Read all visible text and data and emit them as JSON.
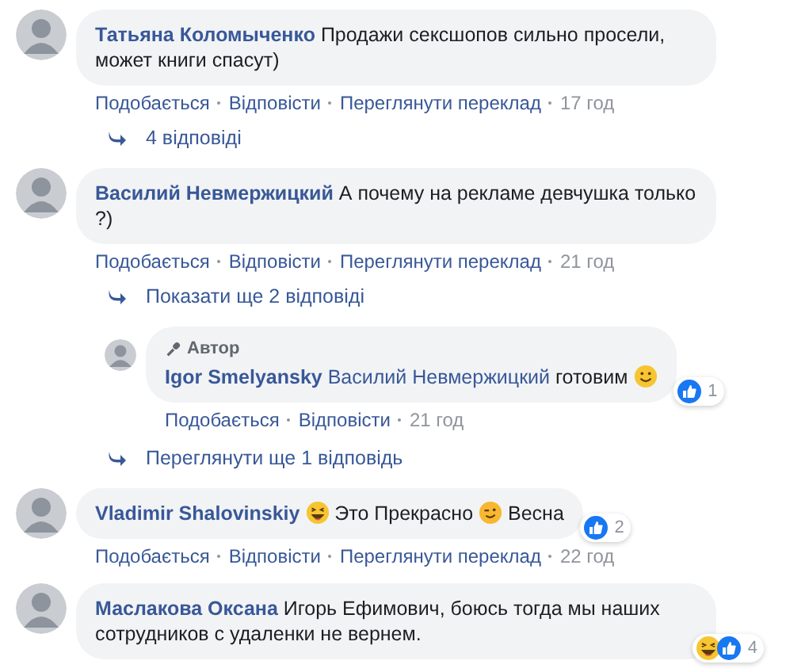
{
  "comments": [
    {
      "kind": "comment",
      "author": "Татьяна Коломыченко",
      "segments": [
        {
          "kind": "text",
          "text": "Продажи сексшопов сильно просели, может книги спасут)"
        }
      ],
      "actions": [
        "Подобається",
        "Відповісти",
        "Переглянути переклад"
      ],
      "time": "17 год",
      "children": [
        {
          "kind": "more",
          "text": "4 відповіді"
        }
      ]
    },
    {
      "kind": "comment",
      "author": "Василий Невмержицкий",
      "segments": [
        {
          "kind": "text",
          "text": "А почему на рекламе девчушка только ?)"
        }
      ],
      "actions": [
        "Подобається",
        "Відповісти",
        "Переглянути переклад"
      ],
      "time": "21 год",
      "children": [
        {
          "kind": "more",
          "text": "Показати ще 2 відповіді"
        },
        {
          "kind": "comment",
          "badge": "Автор",
          "author": "Igor Smelyansky",
          "segments": [
            {
              "kind": "mention",
              "text": "Василий Невмержицкий"
            },
            {
              "kind": "text",
              "text": "готовим"
            },
            {
              "kind": "smile"
            }
          ],
          "reactions": {
            "items": [
              {
                "kind": "like"
              }
            ],
            "count": "1"
          },
          "actions": [
            "Подобається",
            "Відповісти"
          ],
          "time": "21 год"
        },
        {
          "kind": "more",
          "text": "Переглянути ще 1 відповідь"
        }
      ]
    },
    {
      "kind": "comment",
      "author": "Vladimir Shalovinskiy",
      "segments": [
        {
          "kind": "laugh"
        },
        {
          "kind": "text",
          "text": "Это Прекрасно"
        },
        {
          "kind": "wink"
        },
        {
          "kind": "text",
          "text": "Весна"
        }
      ],
      "reactions": {
        "items": [
          {
            "kind": "like"
          }
        ],
        "count": "2"
      },
      "actions": [
        "Подобається",
        "Відповісти",
        "Переглянути переклад"
      ],
      "time": "22 год"
    },
    {
      "kind": "comment",
      "author": "Маслакова Оксана",
      "segments": [
        {
          "kind": "text",
          "text": "Игорь Ефимович, боюсь тогда мы наших сотрудников с удаленки не вернем."
        }
      ],
      "reactions": {
        "items": [
          {
            "kind": "haha"
          },
          {
            "kind": "like"
          }
        ],
        "count": "4"
      }
    }
  ]
}
